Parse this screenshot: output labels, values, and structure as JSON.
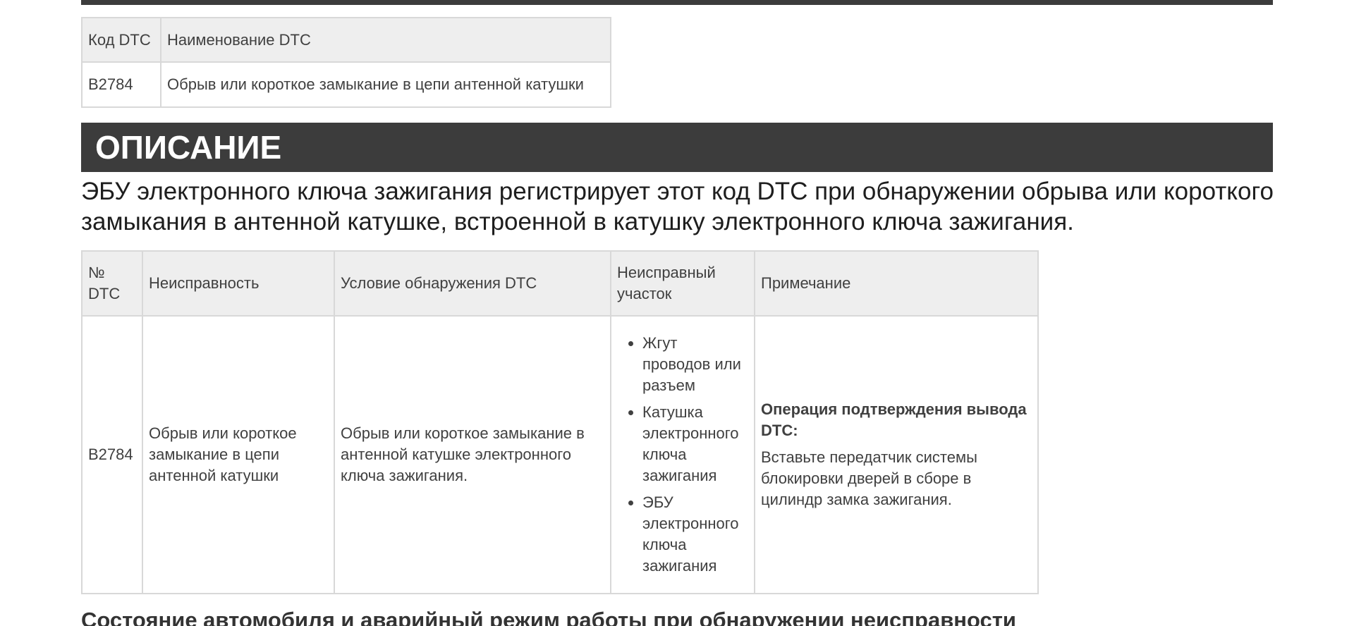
{
  "dtc_summary": {
    "headers": [
      "Код DTC",
      "Наименование DTC"
    ],
    "row": [
      "B2784",
      "Обрыв или короткое замыкание в цепи антенной катушки"
    ]
  },
  "description": {
    "title": "ОПИСАНИЕ",
    "text": "ЭБУ электронного ключа зажигания регистрирует этот код DTC при обнаружении обрыва или короткого замыкания в антенной катушке, встроенной в катушку электронного ключа зажигания."
  },
  "dtc_table": {
    "headers": {
      "no": "№ DTC",
      "fault": "Неисправность",
      "condition": "Условие обнаружения DTC",
      "area": "Неисправный участок",
      "note": "Примечание"
    },
    "row": {
      "no": "B2784",
      "fault": "Обрыв или короткое замыкание в цепи антенной катушки",
      "condition": "Обрыв или короткое замыкание в антенной катушке электронного ключа зажигания.",
      "areas": [
        "Жгут проводов или разъем",
        "Катушка электронного ключа зажигания",
        "ЭБУ электронного ключа зажигания"
      ],
      "note_title": "Операция подтверждения вывода DTC:",
      "note_text": "Вставьте передатчик системы блокировки дверей в сборе в цилиндр замка зажигания."
    }
  },
  "next_section": {
    "heading": "Состояние автомобиля и аварийный режим работы при обнаружении неисправности"
  }
}
